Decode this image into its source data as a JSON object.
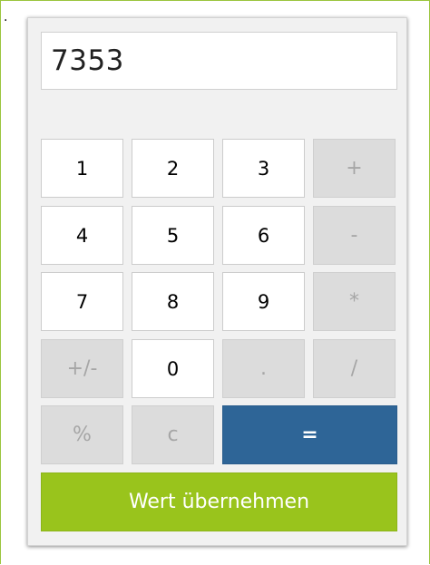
{
  "display": {
    "value": "7353"
  },
  "marker": ".",
  "keys": {
    "k1": "1",
    "k2": "2",
    "k3": "3",
    "plus": "+",
    "k4": "4",
    "k5": "5",
    "k6": "6",
    "minus": "-",
    "k7": "7",
    "k8": "8",
    "k9": "9",
    "multiply": "*",
    "sign": "+/-",
    "k0": "0",
    "decimal": ".",
    "divide": "/",
    "percent": "%",
    "clear": "c",
    "equals": "="
  },
  "apply_label": "Wert übernehmen",
  "colors": {
    "frame_border": "#9bc53d",
    "panel_bg": "#f1f1f1",
    "operator_bg": "#dcdcdc",
    "operator_text": "#a6a6a6",
    "equals_bg": "#2e6597",
    "apply_bg": "#99c41c"
  }
}
